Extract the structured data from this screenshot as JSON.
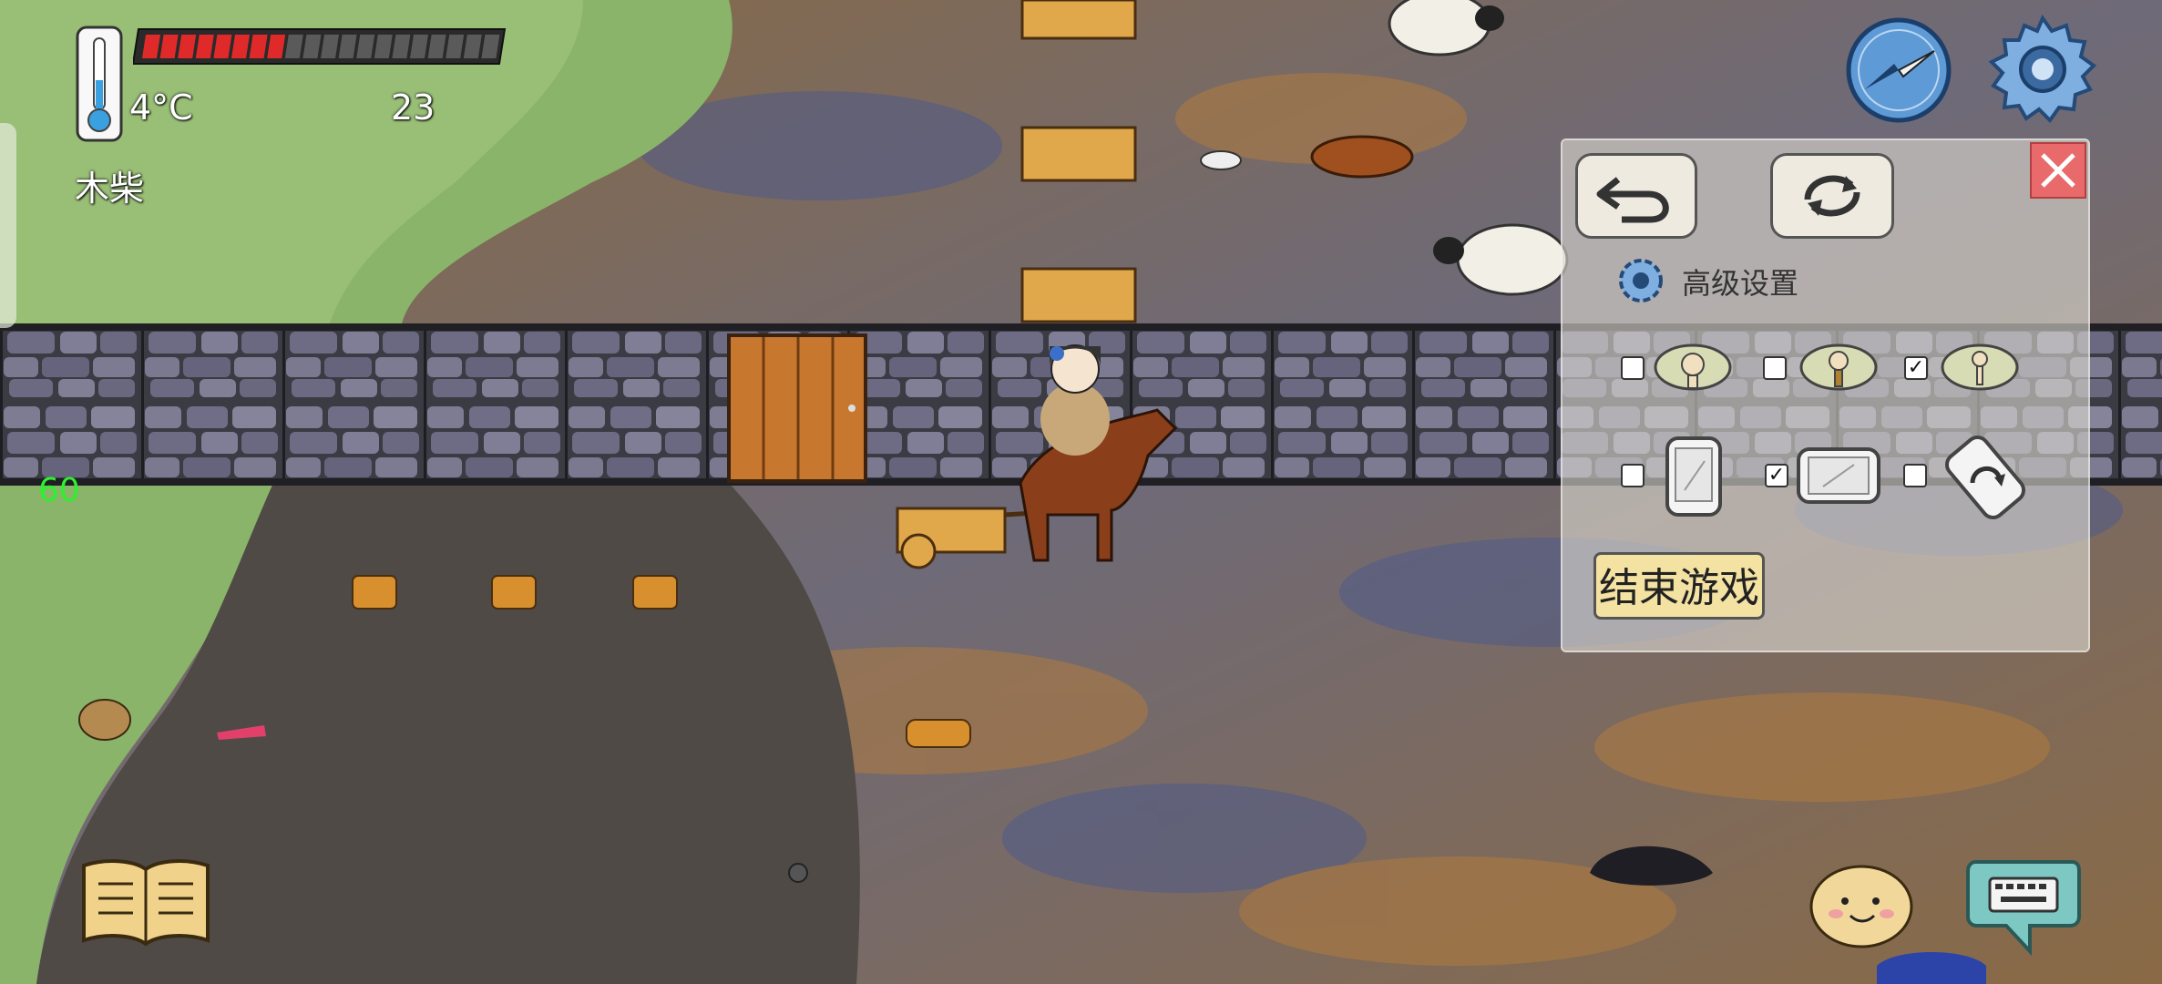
{
  "hud": {
    "temperature": "4°C",
    "food_count": "23",
    "held_item": "木柴",
    "fps": "60",
    "health_segments_total": 20,
    "health_segments_filled": 8
  },
  "settings_panel": {
    "title": "高级设置",
    "end_game_label": "结束游戏",
    "view_options": [
      {
        "checked": false
      },
      {
        "checked": false
      },
      {
        "checked": true
      }
    ],
    "orientation_options": [
      {
        "checked": false
      },
      {
        "checked": true
      },
      {
        "checked": false
      }
    ]
  },
  "colors": {
    "health_red": "#e02a2a",
    "fps_green": "#2ef02e",
    "panel_bg": "#dcd8d0"
  }
}
